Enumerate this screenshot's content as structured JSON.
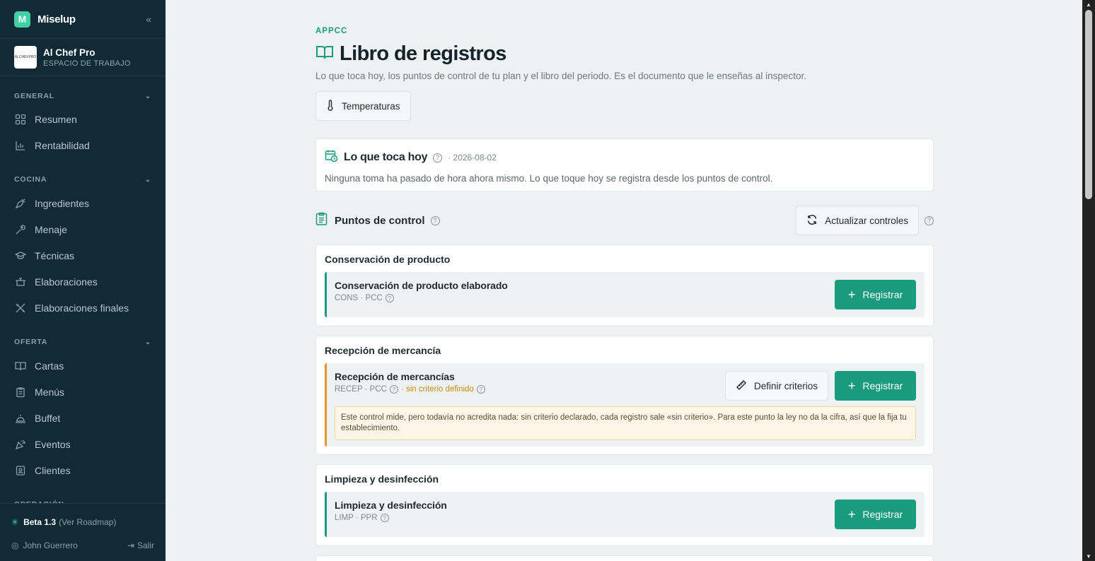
{
  "app": {
    "brand": "Miselup",
    "brand_letter": "M",
    "collapse": "«"
  },
  "workspace": {
    "name": "Al Chef Pro",
    "subtitle": "ESPACIO DE TRABAJO",
    "logo_text": "ALCHEFPRO"
  },
  "sidebar": {
    "sections": [
      {
        "label": "GENERAL",
        "items": [
          {
            "label": "Resumen",
            "icon": "grid-icon"
          },
          {
            "label": "Rentabilidad",
            "icon": "bar-chart-icon"
          }
        ]
      },
      {
        "label": "COCINA",
        "items": [
          {
            "label": "Ingredientes",
            "icon": "carrot-icon"
          },
          {
            "label": "Menaje",
            "icon": "tools-icon"
          },
          {
            "label": "Técnicas",
            "icon": "graduation-cap-icon"
          },
          {
            "label": "Elaboraciones",
            "icon": "pot-icon"
          },
          {
            "label": "Elaboraciones finales",
            "icon": "utensils-icon"
          }
        ]
      },
      {
        "label": "OFERTA",
        "items": [
          {
            "label": "Cartas",
            "icon": "book-open-icon"
          },
          {
            "label": "Menús",
            "icon": "clipboard-icon"
          },
          {
            "label": "Buffet",
            "icon": "cloche-icon"
          },
          {
            "label": "Eventos",
            "icon": "party-icon"
          },
          {
            "label": "Clientes",
            "icon": "contact-icon"
          }
        ]
      },
      {
        "label": "OPERACIÓN",
        "items": []
      }
    ],
    "footer": {
      "version": "Beta 1.3",
      "roadmap": "(Ver Roadmap)",
      "user": "John Guerrero",
      "logout": "Salir"
    }
  },
  "page": {
    "eyebrow": "APPCC",
    "title": "Libro de registros",
    "subtitle": "Lo que toca hoy, los puntos de control de tu plan y el libro del periodo. Es el documento que le enseñas al inspector.",
    "temp_button": "Temperaturas"
  },
  "today": {
    "title": "Lo que toca hoy",
    "date": "· 2026-08-02",
    "text": "Ninguna toma ha pasado de hora ahora mismo. Lo que toque hoy se registra desde los puntos de control."
  },
  "control_points": {
    "title": "Puntos de control",
    "update_button": "Actualizar controles",
    "register_label": "Registrar",
    "criteria_label": "Definir criterios",
    "groups": [
      {
        "title": "Conservación de producto",
        "control": {
          "name": "Conservación de producto elaborado",
          "meta": "CONS · PCC"
        }
      },
      {
        "title": "Recepción de mercancía",
        "control": {
          "name": "Recepción de mercancías",
          "meta": "RECEP · PCC",
          "no_criteria": "· sin criterio definido",
          "warning": "Este control mide, pero todavía no acredita nada: sin criterio declarado, cada registro sale «sin criterio». Para este punto la ley no da la cifra, así que la fija tu establecimiento."
        }
      },
      {
        "title": "Limpieza y desinfección",
        "control": {
          "name": "Limpieza y desinfección",
          "meta": "LIMP · PPR"
        }
      }
    ]
  },
  "colors": {
    "sidebar_bg": "#112a35",
    "accent": "#1a9b7d",
    "warning": "#e8962a"
  }
}
